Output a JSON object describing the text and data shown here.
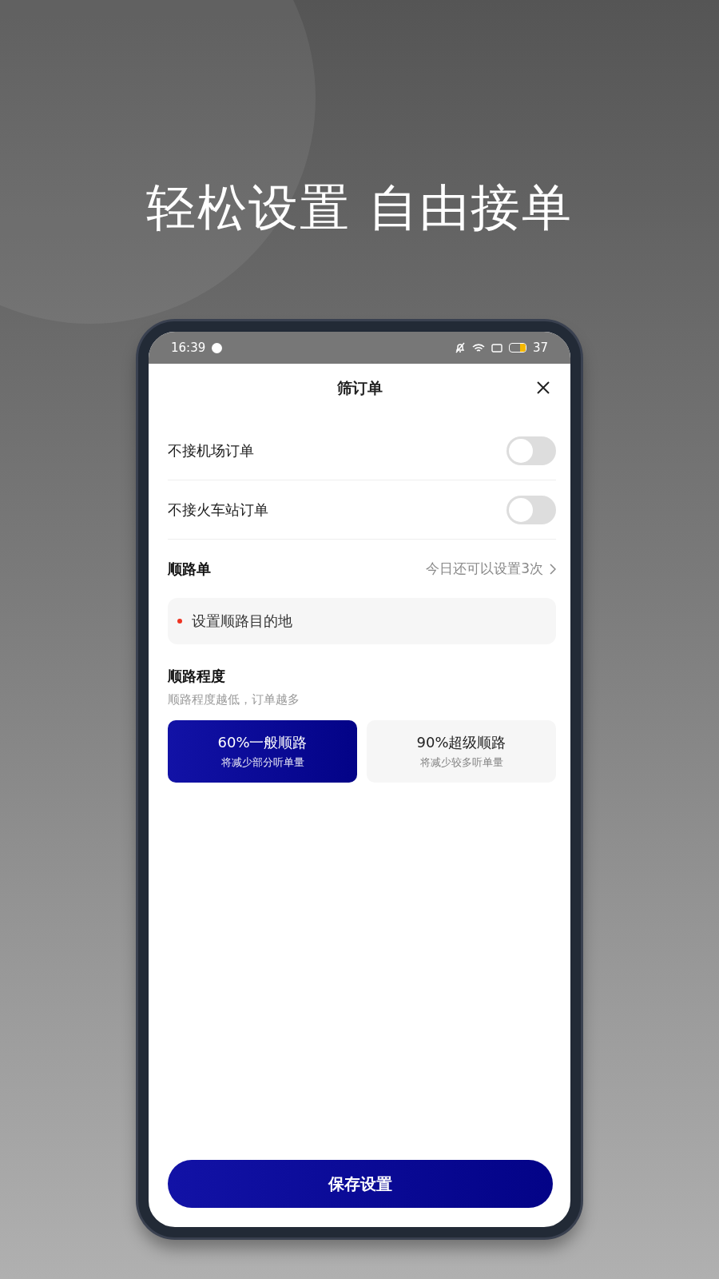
{
  "headline": "轻松设置 自由接单",
  "status_bar": {
    "time": "16:39",
    "battery_text": "37"
  },
  "sheet": {
    "title": "筛订单"
  },
  "toggles": [
    {
      "label": "不接机场订单",
      "on": false
    },
    {
      "label": "不接火车站订单",
      "on": false
    }
  ],
  "route_order": {
    "title": "顺路单",
    "hint": "今日还可以设置3次",
    "destination": "设置顺路目的地"
  },
  "route_degree": {
    "title": "顺路程度",
    "subtitle": "顺路程度越低，订单越多",
    "options": [
      {
        "title": "60%一般顺路",
        "note": "将减少部分听单量",
        "selected": true
      },
      {
        "title": "90%超级顺路",
        "note": "将减少较多听单量",
        "selected": false
      }
    ]
  },
  "save_button": "保存设置"
}
